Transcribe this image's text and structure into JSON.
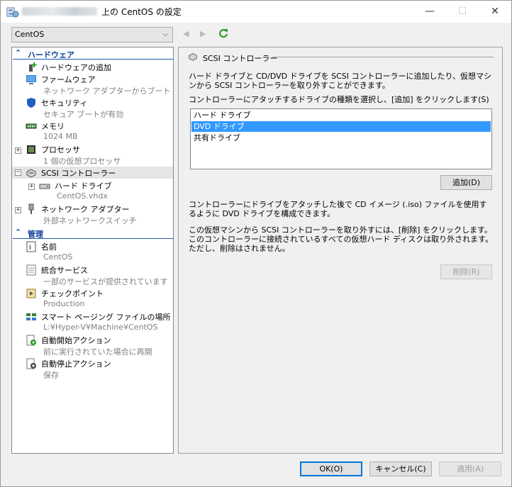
{
  "window": {
    "title": "上の CentOS の設定",
    "controls": {
      "minimize": "—",
      "maximize": "☐",
      "close": "✕"
    }
  },
  "toolbar": {
    "vm_selected": "CentOS"
  },
  "tree": {
    "hardware_header": "ハードウェア",
    "management_header": "管理",
    "hardware_items": [
      {
        "name": "add-hardware",
        "label": "ハードウェアの追加",
        "sub": ""
      },
      {
        "name": "firmware",
        "label": "ファームウェア",
        "sub": "ネットワーク アダプターからブート"
      },
      {
        "name": "security",
        "label": "セキュリティ",
        "sub": "セキュア ブートが有効"
      },
      {
        "name": "memory",
        "label": "メモリ",
        "sub": "1024 MB"
      },
      {
        "name": "processor",
        "label": "プロセッサ",
        "sub": "1 個の仮想プロセッサ"
      },
      {
        "name": "scsi-controller",
        "label": "SCSI コントローラー",
        "sub": ""
      },
      {
        "name": "hard-drive",
        "label": "ハード ドライブ",
        "sub": "CentOS.vhdx"
      },
      {
        "name": "network-adapter",
        "label": "ネットワーク アダプター",
        "sub": "外部ネットワークスイッチ"
      }
    ],
    "management_items": [
      {
        "name": "vm-name",
        "label": "名前",
        "sub": "CentOS"
      },
      {
        "name": "integration-services",
        "label": "統合サービス",
        "sub": "一部のサービスが提供されています"
      },
      {
        "name": "checkpoints",
        "label": "チェックポイント",
        "sub": "Production"
      },
      {
        "name": "smart-paging",
        "label": "スマート ページング ファイルの場所",
        "sub": "L:¥Hyper-V¥Machine¥CentOS"
      },
      {
        "name": "auto-start",
        "label": "自動開始アクション",
        "sub": "前に実行されていた場合に再開"
      },
      {
        "name": "auto-stop",
        "label": "自動停止アクション",
        "sub": "保存"
      }
    ]
  },
  "panel": {
    "title": "SCSI コントローラー",
    "intro": "ハード ドライブと CD/DVD ドライブを SCSI コントローラーに追加したり、仮想マシンから SCSI コントローラーを取り外すことができます。",
    "select_prompt": "コントローラーにアタッチするドライブの種類を選択し、[追加] をクリックします(S)",
    "drive_types": [
      "ハード ドライブ",
      "DVD ドライブ",
      "共有ドライブ"
    ],
    "selected_drive_index": 1,
    "add_button": "追加(D)",
    "attach_note": "コントローラーにドライブをアタッチした後で CD イメージ (.iso) ファイルを使用するように DVD ドライブを構成できます。",
    "remove_note": "この仮想マシンから SCSI コントローラーを取り外すには、[削除] をクリックします。このコントローラーに接続されているすべての仮想ハード ディスクは取り外されます。ただし、削除はされません。",
    "remove_button": "削除(R)"
  },
  "footer": {
    "ok_button": "OK(O)",
    "cancel_button": "キャンセル(C)",
    "apply_button": "適用(A)"
  },
  "colors": {
    "accent": "#0b3e99",
    "selection": "#3399ff",
    "refresh_green": "#2f9e2f"
  }
}
